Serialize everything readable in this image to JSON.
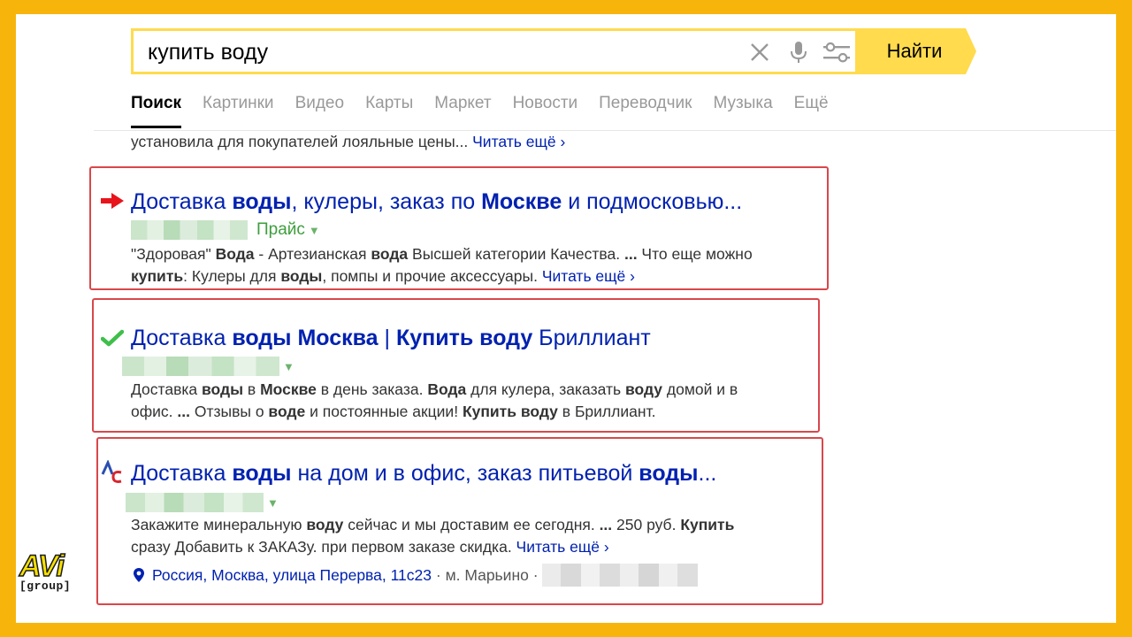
{
  "search": {
    "query": "купить воду",
    "button_label": "Найти"
  },
  "tabs": [
    {
      "label": "Поиск",
      "active": true
    },
    {
      "label": "Картинки"
    },
    {
      "label": "Видео"
    },
    {
      "label": "Карты"
    },
    {
      "label": "Маркет"
    },
    {
      "label": "Новости"
    },
    {
      "label": "Переводчик"
    },
    {
      "label": "Музыка"
    },
    {
      "label": "Ещё"
    }
  ],
  "top_snippet": {
    "text": "установила для покупателей лояльные цены... ",
    "more": "Читать ещё ›"
  },
  "results": [
    {
      "marker": "red-arrow",
      "title_parts": [
        "Доставка ",
        "воды",
        ", кулеры, заказ по ",
        "Москве",
        " и подмосковью..."
      ],
      "url_extra": "Прайс",
      "snippet_line1_parts": [
        "\"Здоровая\" ",
        "Вода",
        " - Артезианская ",
        "вода",
        " Высшей категории Качества. ",
        "...",
        " Что еще можно"
      ],
      "snippet_line2_parts": [
        "купить",
        ": Кулеры для ",
        "воды",
        ", помпы и прочие аксессуары. "
      ],
      "more": "Читать ещё ›"
    },
    {
      "marker": "green-check",
      "title_parts": [
        "Доставка ",
        "воды Москва",
        " | ",
        "Купить воду",
        " Бриллиант"
      ],
      "snippet_line1_parts": [
        "Доставка ",
        "воды",
        " в ",
        "Москве",
        " в день заказа. ",
        "Вода",
        " для кулера, заказать ",
        "воду",
        " домой и в"
      ],
      "snippet_line2_parts": [
        "офис. ",
        "...",
        " Отзывы о ",
        "воде",
        " и постоянные акции! ",
        "Купить воду",
        " в Бриллиант."
      ]
    },
    {
      "marker": "site-favicon",
      "title_parts": [
        "Доставка ",
        "воды",
        " на дом и в офис, заказ питьевой ",
        "воды",
        "..."
      ],
      "snippet_line1_parts": [
        "Закажите минеральную ",
        "воду",
        " сейчас и мы доставим ее сегодня. ",
        "...",
        " 250 руб. ",
        "Купить"
      ],
      "snippet_line2_parts": [
        "сразу Добавить к ЗАКАЗу. при первом заказе скидка. "
      ],
      "more": "Читать ещё ›",
      "address": "Россия, Москва, улица Перерва, 11с23",
      "separator": " · ",
      "metro": "м. Марьино",
      "sep2": " · "
    }
  ],
  "logo": {
    "main": "AVi",
    "sub": "[group]"
  },
  "icons": [
    "close-icon",
    "microphone-icon",
    "settings-sliders-icon",
    "red-arrow-icon",
    "check-icon",
    "favicon-icon",
    "location-pin-icon",
    "caret-down-icon"
  ],
  "colors": {
    "accent": "#ffdb4d",
    "link": "#0021b0",
    "frame": "#d9474b",
    "url_green": "#3d9e3d",
    "background": "#f7b50c"
  }
}
